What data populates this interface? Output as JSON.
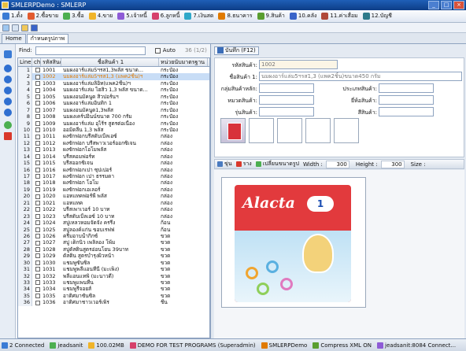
{
  "window": {
    "title": "SMLERPDemo : SMLERP"
  },
  "menu": [
    {
      "label": "1.ตั้ง",
      "color": "#3a7bd5"
    },
    {
      "label": "2.ซื้อขาย",
      "color": "#e25b2f"
    },
    {
      "label": "3.ซื้อ",
      "color": "#4caf50"
    },
    {
      "label": "4.ขาย",
      "color": "#f0b429"
    },
    {
      "label": "5.เจ้าหนี้",
      "color": "#8e5bd6"
    },
    {
      "label": "6.ลูกหนี้",
      "color": "#d6406b"
    },
    {
      "label": "7.เงินสด",
      "color": "#2fa8c9"
    },
    {
      "label": "8.ธนาคาร",
      "color": "#e07a00"
    },
    {
      "label": "9.สินค้า",
      "color": "#5a9e2f"
    },
    {
      "label": "10.คลัง",
      "color": "#3a64c9"
    },
    {
      "label": "11.ค่าเสื่อม",
      "color": "#b0493a"
    },
    {
      "label": "12.บัญชี",
      "color": "#2d7a8a"
    }
  ],
  "tabs": [
    {
      "label": "Home",
      "active": false
    },
    {
      "label": "กำหนดรูปภาพ",
      "active": true
    }
  ],
  "find": {
    "label": "Find:",
    "value": "",
    "auto_label": "Auto",
    "count": "36 (1/2)"
  },
  "grid": {
    "headers": [
      "Line",
      "ch",
      "รหัสสินค้า",
      "ชื่อสินค้า 1",
      "หน่วยนับมาตรฐาน"
    ],
    "rows": [
      [
        "1",
        "1001",
        "นมผงอาร์แล่ม5ฯรส1,3พลัส ขนาด...",
        "กระป๋อง"
      ],
      [
        "2",
        "1002",
        "นมผงอาร์แล่ม5ฯรส1,3 (แพค2ชิ้น)ฯ",
        "กระป๋อง"
      ],
      [
        "3",
        "1003",
        "นมผงอาร์แล่มลิอิท(แพค2ชิ้น)ฯ",
        "กระป๋อง"
      ],
      [
        "4",
        "1004",
        "นมผงอาร์แล่ม ไฮสิว 1,3 พลัส ขนาด...",
        "กระป๋อง"
      ],
      [
        "5",
        "1005",
        "นมผงอนมัคนูด สิวปอร์นฯ",
        "กระป๋อง"
      ],
      [
        "6",
        "1006",
        "นมผงอาร์แล่มอินทิก 1",
        "กระป๋อง"
      ],
      [
        "7",
        "1007",
        "นมผงอนมัคนูด1,3พลัส",
        "กระป๋อง"
      ],
      [
        "8",
        "1008",
        "นมผงเคร์ปอินน์ขนาด 700 กรัม",
        "กระป๋อง"
      ],
      [
        "9",
        "1009",
        "นมผงอาร์แล่ม อุไร้ร สูตรต่อเนื่อง",
        "กระป๋อง"
      ],
      [
        "10",
        "1010",
        "ออมิดลีน 1,3 พลัส",
        "กระป๋อง"
      ],
      [
        "11",
        "1011",
        "ผงซักฟอกบรีสดับเบิ้ลเอซ์",
        "กล่อง"
      ],
      [
        "12",
        "1012",
        "ผงซักฟอก บรีสพาวเวอร์ออกซิเจน",
        "กล่อง"
      ],
      [
        "13",
        "1013",
        "ผงซักฟอกโอโมพลัส",
        "กล่อง"
      ],
      [
        "14",
        "1014",
        "บรีสคอมฟอร์ท",
        "กล่อง"
      ],
      [
        "15",
        "1015",
        "บรีสออกซิเจน",
        "กล่อง"
      ],
      [
        "16",
        "1016",
        "ผงซักฟอกเปา ซุปเปอร์",
        "กล่อง"
      ],
      [
        "17",
        "1017",
        "ผงซักฟอก เปา ธรรมดา",
        "กล่อง"
      ],
      [
        "18",
        "1018",
        "ผงซักฟอก โอโม",
        "กล่อง"
      ],
      [
        "19",
        "1019",
        "ผงซักฟอกเอเลอร์",
        "กล่อง"
      ],
      [
        "20",
        "1020",
        "แอทแทคฟอร์พี พลัส",
        "กล่อง"
      ],
      [
        "21",
        "1021",
        "แอทแทค",
        "กล่อง"
      ],
      [
        "22",
        "1022",
        "บรีสเพาเวอร์ 10 บาท",
        "กล่อง"
      ],
      [
        "23",
        "1023",
        "บรีสดับเบิ้ลเอซ์ 10 บาท",
        "กล่อง"
      ],
      [
        "24",
        "1024",
        "สบู่เหลวหอมจัดจัง ครรี่ง",
        "ก้อน"
      ],
      [
        "25",
        "1025",
        "สบู่ลองค์แก่น ขอบเรฟฟ",
        "ก้อน"
      ],
      [
        "26",
        "1026",
        "ครีมอาบน้ำกิกซ์",
        "ขวด"
      ],
      [
        "27",
        "1027",
        "สบู่ เด็กนิว เพลิลอง โพ้ม",
        "ขวด"
      ],
      [
        "28",
        "1028",
        "สบู่ดัสตินสูตรอ่อนโยน 39บาท",
        "ขวด"
      ],
      [
        "29",
        "1029",
        "ดัสติน สูตรบำรุงผิวหน้า",
        "ขวด"
      ],
      [
        "30",
        "1030",
        "แชมพูซันซิล",
        "ขวด"
      ],
      [
        "31",
        "1031",
        "แชมพูพลีแอนทีนี (มะเพ็ง)",
        "ขวด"
      ],
      [
        "32",
        "1032",
        "พลีแอนแทพิ (มะนาวดี)",
        "ขวด"
      ],
      [
        "33",
        "1033",
        "แชมพูแพนทีน",
        "ขวด"
      ],
      [
        "34",
        "1034",
        "แชมพูรีจอยส์",
        "ขวด"
      ],
      [
        "35",
        "1035",
        "อาติศมาซันซิล",
        "ขวด"
      ],
      [
        "36",
        "1036",
        "อาติศมาชาวเวอร์เพิร",
        "ชิ้น"
      ]
    ],
    "selected_index": 1
  },
  "form": {
    "save_label": "บันทึก (F12)",
    "code_label": "รหัสสินค้า:",
    "code_value": "1002",
    "name_label": "ชื่อสินค้า 1:",
    "name_value": "นมผงอาร์แล่ม5ฯรส1,3 (แพค2ชิ้น)ขนาด450 กรัม",
    "group_main_label": "กลุ่มสินค้าหลัก:",
    "type_label": "ประเภทสินค้า:",
    "category_label": "หมวดสินค้า:",
    "brand_label": "ยี่ห้อสินค้า:",
    "model_label": "รุ่นสินค้า:",
    "color_label": "สีสินค้า:"
  },
  "image_toolbar": {
    "zoom_in": "ขุ่น",
    "zoom_out": "ราง",
    "change_size": "เปลี่ยนขนาดรูป",
    "width_label": "Width :",
    "width_value": "300",
    "height_label": "Height :",
    "height_value": "300",
    "size_label": "Size :"
  },
  "product_image": {
    "brand": "Alacta",
    "badge": "1"
  },
  "status": [
    {
      "label": "2 Connected",
      "color": "#3a7bd5"
    },
    {
      "label": "jeadsanit",
      "color": "#4caf50"
    },
    {
      "label": "100.02MB",
      "color": "#f0b429"
    },
    {
      "label": "DEMO FOR TEST PROGRAMS (Superadmin)",
      "color": "#d6406b"
    },
    {
      "label": "SMLERPDemo",
      "color": "#e07a00"
    },
    {
      "label": "Compress XML ON",
      "color": "#5a9e2f"
    },
    {
      "label": "jeadsanit:8084 Connect...",
      "color": "#8e5bd6"
    }
  ]
}
